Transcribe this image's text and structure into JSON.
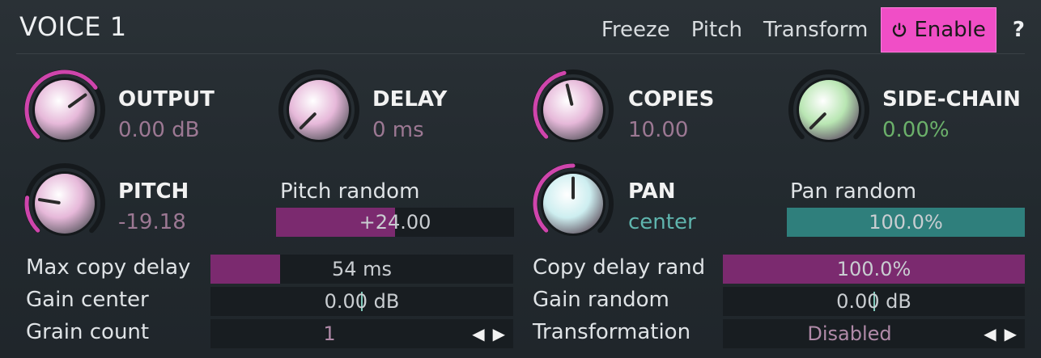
{
  "header": {
    "title": "VOICE 1",
    "menu": [
      "Freeze",
      "Pitch",
      "Transform"
    ],
    "enable_label": "Enable",
    "help_label": "?"
  },
  "knobs": {
    "output": {
      "label": "OUTPUT",
      "value": "0.00 dB",
      "level": 0.7
    },
    "delay": {
      "label": "DELAY",
      "value": "0 ms",
      "level": 0.0
    },
    "copies": {
      "label": "COPIES",
      "value": "10.00",
      "level": 0.45
    },
    "sidechain": {
      "label": "SIDE-CHAIN",
      "value": "0.00%",
      "level": 0.0
    },
    "pitch": {
      "label": "PITCH",
      "value": "-19.18",
      "level": 0.2
    },
    "pan": {
      "label": "PAN",
      "value": "center",
      "level": 0.5
    }
  },
  "params": {
    "pitch_random": {
      "label": "Pitch random",
      "value": "+24.00",
      "level": 0.5
    },
    "pan_random": {
      "label": "Pan random",
      "value": "100.0%",
      "level": 1.0
    },
    "max_copy_delay": {
      "label": "Max copy delay",
      "value": "54 ms",
      "level": 0.23
    },
    "copy_delay_rand": {
      "label": "Copy delay rand",
      "value": "100.0%",
      "level": 1.0
    },
    "gain_center": {
      "label": "Gain center",
      "value": "0.00 dB"
    },
    "gain_random": {
      "label": "Gain random",
      "value": "0.00 dB"
    },
    "grain_count": {
      "label": "Grain count",
      "value": "1"
    },
    "transformation": {
      "label": "Transformation",
      "value": "Disabled"
    }
  },
  "colors": {
    "accent_pink": "#f04ec6",
    "knob_pink": "#e6b8d9",
    "knob_green": "#b9e6b3",
    "knob_cyan": "#cdeef0",
    "fill_purple": "#7b2a6f",
    "fill_teal": "#2f7f7c"
  },
  "icons": {
    "power": "power-icon",
    "arrow_left": "arrow-left-icon",
    "arrow_right": "arrow-right-icon"
  }
}
